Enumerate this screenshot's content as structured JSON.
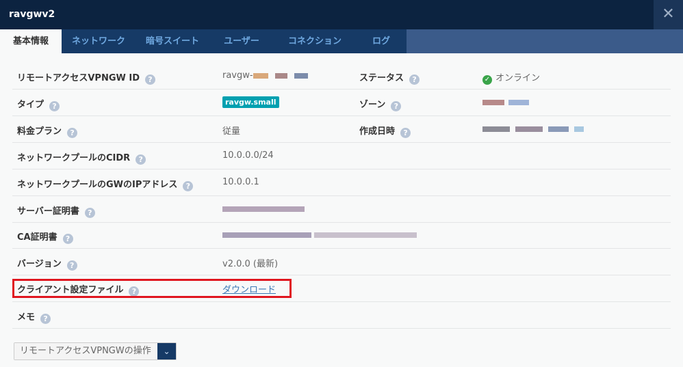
{
  "window": {
    "title": "ravgwv2",
    "close_icon": "close-x-icon"
  },
  "tabs": [
    {
      "label": "基本情報",
      "active": true
    },
    {
      "label": "ネットワーク"
    },
    {
      "label": "暗号スイート"
    },
    {
      "label": "ユーザー"
    },
    {
      "label": "コネクション"
    },
    {
      "label": "ログ"
    }
  ],
  "fields": {
    "id": {
      "label": "リモートアクセスVPNGW ID",
      "value_prefix": "ravgw-"
    },
    "status": {
      "label": "ステータス",
      "value": "オンライン",
      "color": "#3aa44a"
    },
    "type": {
      "label": "タイプ",
      "value": "ravgw.small",
      "color": "#00a0b0"
    },
    "zone": {
      "label": "ゾーン"
    },
    "plan": {
      "label": "料金プラン",
      "value": "従量"
    },
    "created": {
      "label": "作成日時"
    },
    "cidr": {
      "label": "ネットワークプールのCIDR",
      "value": "10.0.0.0/24"
    },
    "gw": {
      "label": "ネットワークプールのGWのIPアドレス",
      "value": "10.0.0.1"
    },
    "server_cert": {
      "label": "サーバー証明書"
    },
    "ca_cert": {
      "label": "CA証明書"
    },
    "version": {
      "label": "バージョン",
      "value": "v2.0.0 (最新)"
    },
    "client_config": {
      "label": "クライアント設定ファイル",
      "link": "ダウンロード"
    },
    "memo": {
      "label": "メモ"
    }
  },
  "help_icon": "?",
  "highlight_color": "#e0161f",
  "actions": {
    "label": "リモートアクセスVPNGWの操作"
  }
}
